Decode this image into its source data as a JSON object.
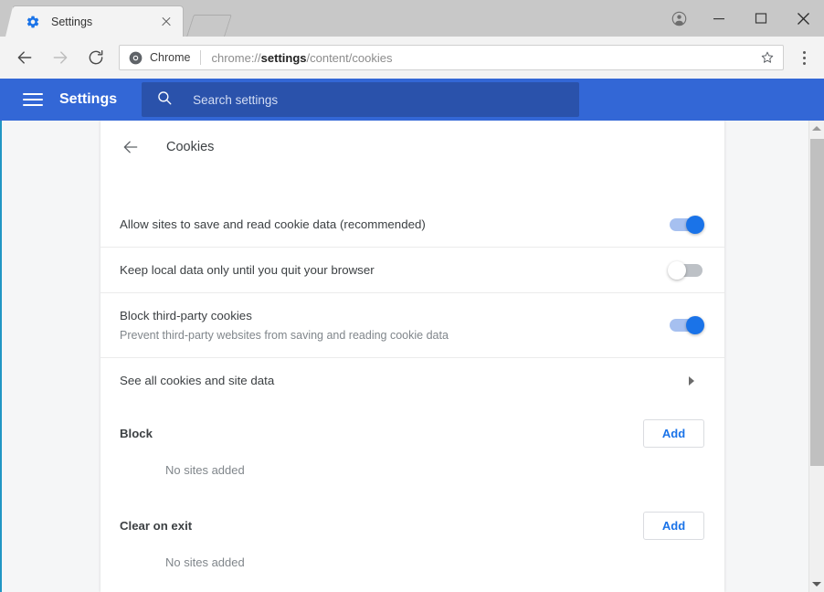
{
  "window": {
    "controls": {
      "avatar_label": "profile-avatar",
      "minimize_label": "Minimize",
      "maximize_label": "Maximize",
      "close_label": "Close"
    }
  },
  "tab": {
    "title": "Settings",
    "favicon": "gear-icon",
    "close_label": "Close tab",
    "newtab_label": "New tab"
  },
  "toolbar": {
    "back_label": "Back",
    "forward_label": "Forward",
    "reload_label": "Reload",
    "chrome_chip_label": "Chrome",
    "url_prefix": "chrome://",
    "url_bold": "settings",
    "url_suffix": "/content/cookies",
    "url_full": "chrome://settings/content/cookies",
    "star_label": "Bookmark this page",
    "menu_label": "Customize and control Google Chrome"
  },
  "settings_header": {
    "menu_label": "Main menu",
    "title": "Settings",
    "search_placeholder": "Search settings",
    "search_value": "",
    "bar_color": "#3367d6",
    "search_bg_color": "#2a52ab"
  },
  "page": {
    "back_label": "Back to previous page",
    "title": "Cookies",
    "rows": [
      {
        "label": "Allow sites to save and read cookie data (recommended)",
        "sub": "",
        "control": "toggle",
        "state": "on"
      },
      {
        "label": "Keep local data only until you quit your browser",
        "sub": "",
        "control": "toggle",
        "state": "off"
      },
      {
        "label": "Block third-party cookies",
        "sub": "Prevent third-party websites from saving and reading cookie data",
        "control": "toggle",
        "state": "on"
      },
      {
        "label": "See all cookies and site data",
        "sub": "",
        "control": "chevron",
        "state": ""
      }
    ],
    "sections": [
      {
        "title": "Block",
        "add_label": "Add",
        "empty_text": "No sites added"
      },
      {
        "title": "Clear on exit",
        "add_label": "Add",
        "empty_text": "No sites added"
      }
    ]
  },
  "scrollbar": {
    "up_label": "Scroll up",
    "down_label": "Scroll down",
    "thumb_label": "Vertical scroll thumb"
  },
  "colors": {
    "accent_blue": "#1a73e8",
    "header_blue": "#3367d6",
    "toggle_on_track": "#a6c0f0",
    "toggle_off_track": "#bdc1c6",
    "text_primary": "#3c4043",
    "text_secondary": "#80868b"
  }
}
